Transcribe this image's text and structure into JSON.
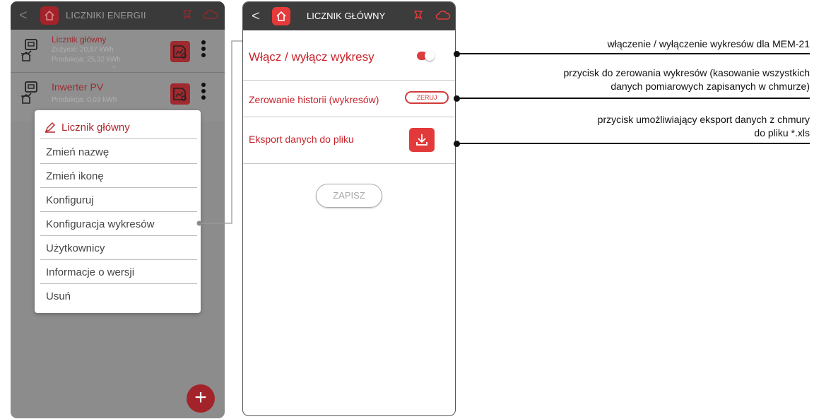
{
  "left_screen": {
    "header_title": "LICZNIKI ENERGII",
    "back_glyph": "<",
    "devices": [
      {
        "name": "Licznik główny",
        "lines": [
          "Zużycie: 20,87 kWh",
          "Produkcja: 25,32 kWh"
        ]
      },
      {
        "name": "Inwerter PV",
        "lines": [
          "Produkcja: 0,03 kWh"
        ]
      }
    ],
    "menu": [
      "Licznik główny",
      "Zmień nazwę",
      "Zmień ikonę",
      "Konfiguruj",
      "Konfiguracja wykresów",
      "Użytkownicy",
      "Informacje o wersji",
      "Usuń"
    ],
    "fab_glyph": "+"
  },
  "right_screen": {
    "header_title": "LICZNIK GŁÓWNY",
    "back_glyph": "<",
    "rows": {
      "toggle_label": "Włącz / wyłącz wykresy",
      "toggle_on": true,
      "reset_label": "Zerowanie historii (wykresów)",
      "reset_button": "ZERUJ",
      "export_label": "Eksport danych do pliku"
    },
    "save_button": "ZAPISZ"
  },
  "annotations": {
    "a1": "włączenie / wyłączenie wykresów dla MEM-21",
    "a2_l1": "przycisk do zerowania wykresów (kasowanie wszystkich",
    "a2_l2": "danych pomiarowych zapisanych w chmurze)",
    "a3_l1": "przycisk umożliwiający eksport danych z chmury",
    "a3_l2": "do pliku *.xls"
  },
  "colors": {
    "accent": "#e23a3a",
    "dark_header": "#3c3c3c"
  },
  "icons": [
    "home-icon",
    "bell-icon",
    "cloud-icon",
    "meter-icon",
    "chart-icon",
    "pencil-icon",
    "download-icon",
    "plus-icon"
  ]
}
